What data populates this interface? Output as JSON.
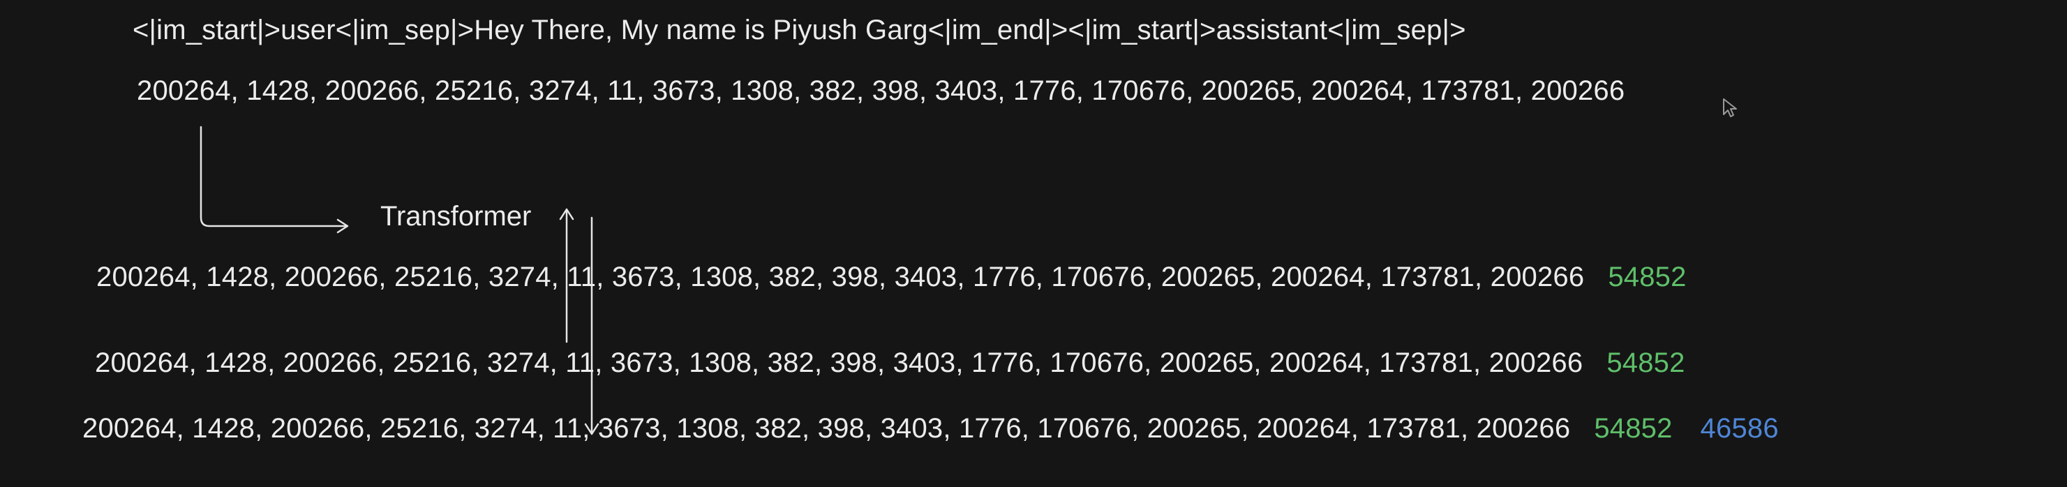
{
  "prompt_text": "<|im_start|>user<|im_sep|>Hey There, My name is Piyush Garg<|im_end|><|im_start|>assistant<|im_sep|>",
  "token_ids": "200264, 1428, 200266, 25216, 3274, 11, 3673, 1308, 382, 398, 3403, 1776, 170676, 200265, 200264, 173781, 200266",
  "transformer_label": "Transformer",
  "rows": [
    {
      "tokens": "200264, 1428, 200266, 25216, 3274, 11, 3673, 1308, 382, 398, 3403, 1776, 170676, 200265, 200264, 173781, 200266",
      "new_1": "54852"
    },
    {
      "tokens": "200264, 1428, 200266, 25216, 3274, 11, 3673, 1308, 382, 398, 3403, 1776, 170676, 200265, 200264, 173781, 200266",
      "new_1": "54852"
    },
    {
      "tokens": "200264, 1428, 200266, 25216, 3274, 11, 3673, 1308, 382, 398, 3403, 1776, 170676, 200265, 200264, 173781, 200266",
      "new_1": "54852",
      "new_2": "46586"
    }
  ],
  "colors": {
    "background": "#151515",
    "text": "#ececec",
    "predicted_token": "#5fbf6a",
    "second_predicted_token": "#4f86d6"
  }
}
